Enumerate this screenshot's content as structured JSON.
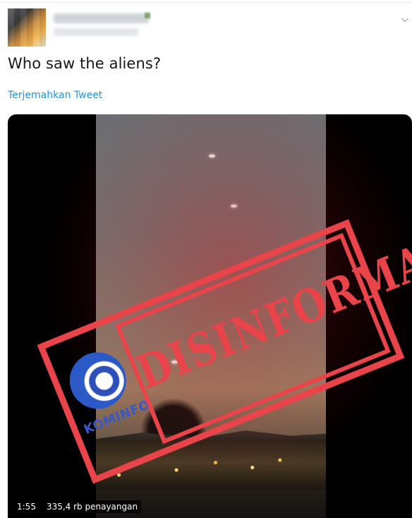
{
  "tweet": {
    "text": "Who saw the aliens?",
    "translate_link": "Terjemahkan Tweet"
  },
  "media": {
    "duration": "1:55",
    "views": "335,4 rb penayangan"
  },
  "stamp": {
    "word": "DISINFORMASI",
    "logo_text": "KOMINFO",
    "color": "#e8444a"
  },
  "colors": {
    "link": "#1b95e0",
    "text": "#14171a",
    "logo_blue": "#3b57c4"
  },
  "icons": {
    "menu": "chevron-down-icon"
  }
}
